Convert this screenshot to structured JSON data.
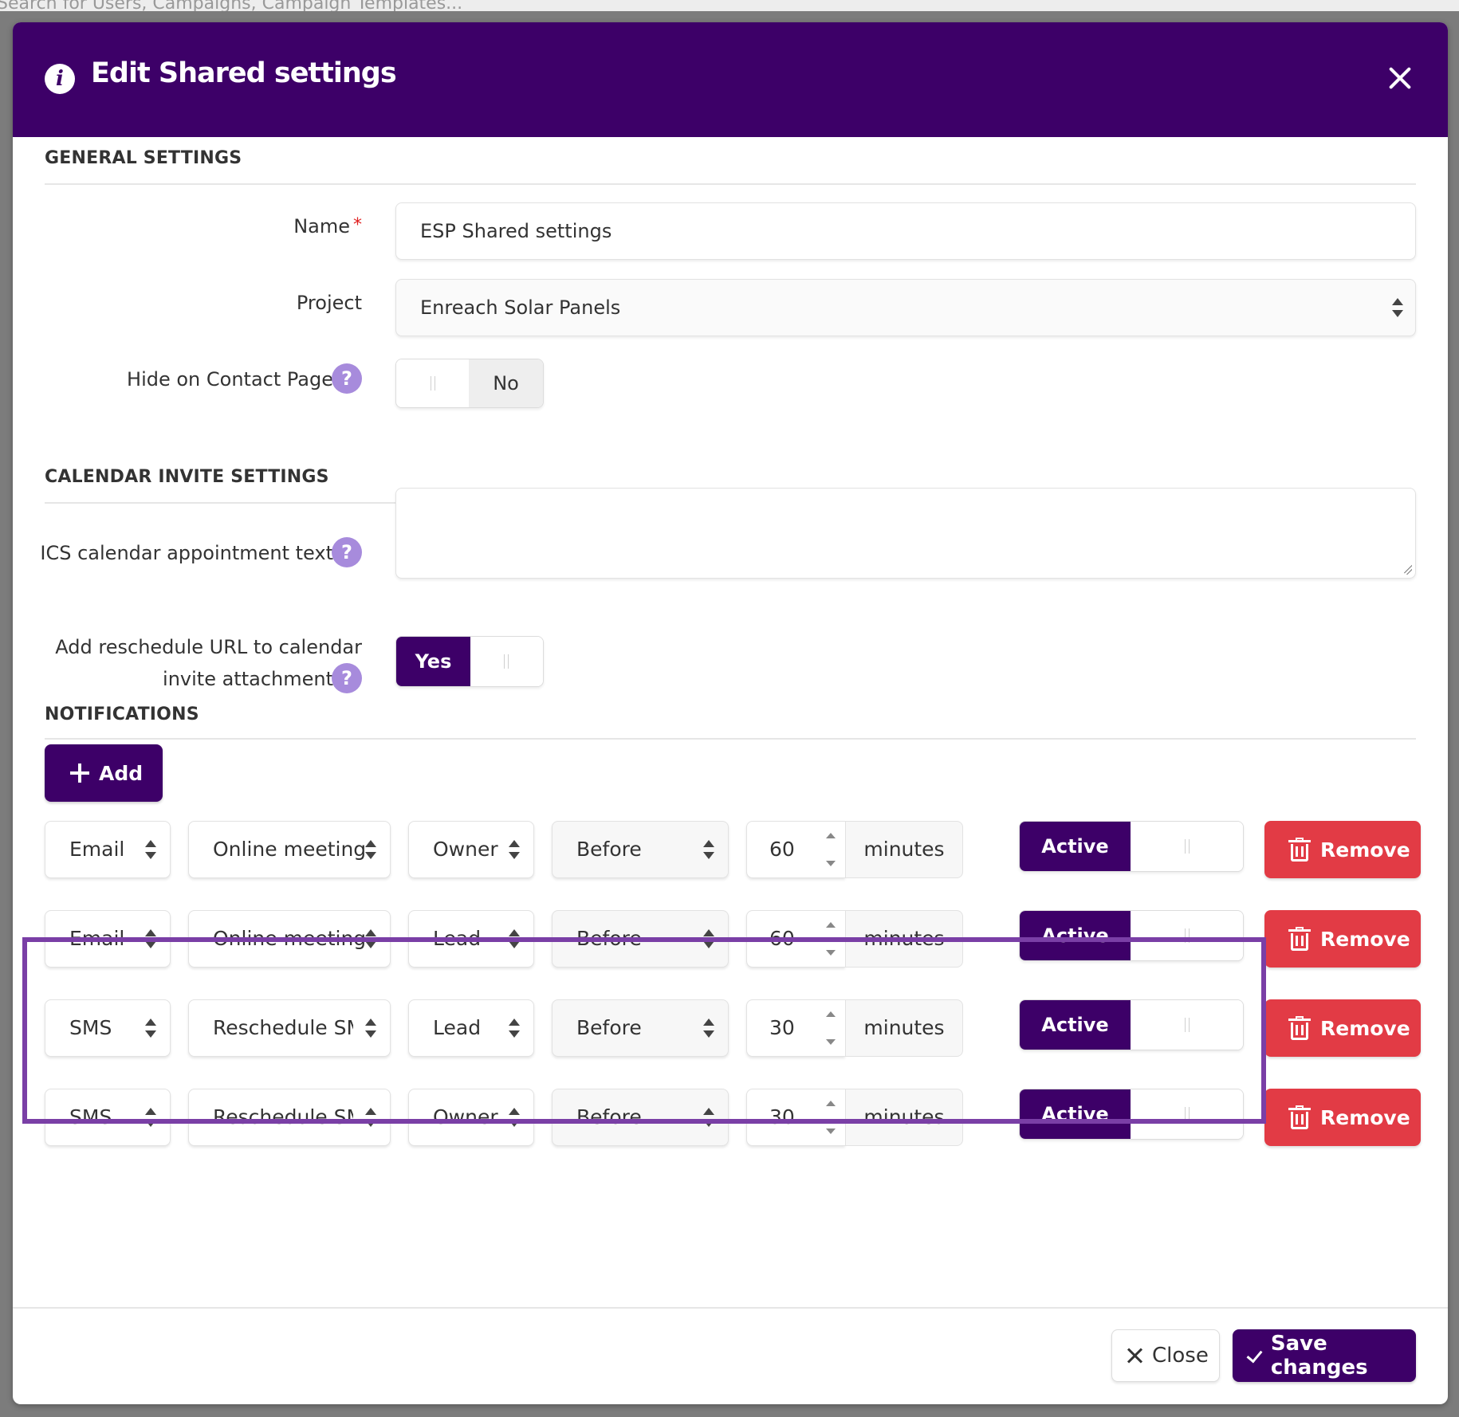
{
  "background": {
    "search_placeholder": "Search for Users, Campaigns, Campaign Templates..."
  },
  "modal": {
    "title": "Edit Shared settings",
    "header_color": "#3d0068"
  },
  "general": {
    "section_title": "GENERAL SETTINGS",
    "name_label": "Name",
    "name_required": "*",
    "name_value": "ESP Shared settings",
    "project_label": "Project",
    "project_value": "Enreach Solar Panels",
    "hide_label": "Hide on Contact Page",
    "hide_value": "No",
    "help": "?"
  },
  "calendar": {
    "section_title": "CALENDAR INVITE SETTINGS",
    "ics_label": "ICS calendar appointment text",
    "ics_value": "",
    "reschedule_label_line1": "Add reschedule URL to calendar",
    "reschedule_label_line2": "invite attachment",
    "reschedule_value": "Yes"
  },
  "notifications": {
    "section_title": "NOTIFICATIONS",
    "add_label": "Add",
    "remove_label": "Remove",
    "active_label": "Active",
    "unit_label": "minutes",
    "rows": [
      {
        "channel": "Email",
        "template": "Online meeting",
        "recipient": "Owner",
        "timing": "Before",
        "amount": "60"
      },
      {
        "channel": "Email",
        "template": "Online meeting",
        "recipient": "Lead",
        "timing": "Before",
        "amount": "60"
      },
      {
        "channel": "SMS",
        "template": "Reschedule SMS",
        "recipient": "Lead",
        "timing": "Before",
        "amount": "30"
      },
      {
        "channel": "SMS",
        "template": "Reschedule SMS",
        "recipient": "Owner",
        "timing": "Before",
        "amount": "30"
      }
    ]
  },
  "footer": {
    "close_label": "Close",
    "save_label": "Save changes"
  },
  "colors": {
    "primary": "#3d0068",
    "danger": "#e23b45",
    "help": "#a78bdc",
    "highlight": "#7a3fa6"
  }
}
